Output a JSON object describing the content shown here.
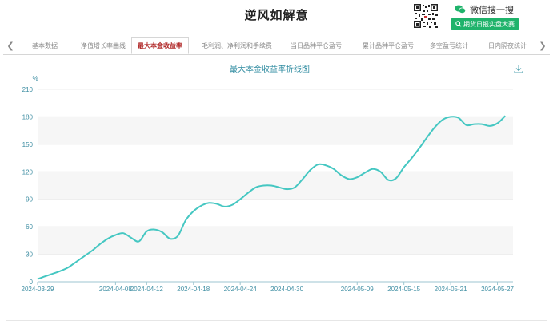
{
  "page": {
    "title": "逆风如解意"
  },
  "wechat": {
    "search_label": "微信搜一搜",
    "search_button": "期货日报实盘大赛"
  },
  "tabs": [
    {
      "label": "基本数据",
      "active": false
    },
    {
      "label": "净值增长率曲线",
      "active": false
    },
    {
      "label": "最大本金收益率",
      "active": true
    },
    {
      "label": "毛利润、净利润和手续费",
      "active": false
    },
    {
      "label": "当日品种平仓盈亏",
      "active": false
    },
    {
      "label": "累计品种平仓盈亏",
      "active": false
    },
    {
      "label": "多空盈亏统计",
      "active": false
    },
    {
      "label": "日内隔夜统计",
      "active": false
    }
  ],
  "colors": {
    "line": "#45c7c2",
    "title": "#2e8ba0",
    "axis_text": "#3f8ea3",
    "active_tab": "#b12a2a",
    "wechat_green": "#1fb36b"
  },
  "icons": [
    "chevron-left-icon",
    "chevron-right-icon",
    "download-icon",
    "wechat-icon",
    "search-icon",
    "qr-code"
  ],
  "chart_data": {
    "type": "line",
    "title": "最大本金收益率折线图",
    "ylabel": "%",
    "xlabel": "",
    "ylim": [
      0,
      210
    ],
    "yticks": [
      0,
      30,
      60,
      90,
      120,
      150,
      180,
      210
    ],
    "xlim": [
      "2024-03-29",
      "2024-05-29"
    ],
    "xticks": [
      "2024-03-29",
      "2024-04-08",
      "2024-04-12",
      "2024-04-18",
      "2024-04-24",
      "2024-04-30",
      "2024-05-09",
      "2024-05-15",
      "2024-05-21",
      "2024-05-27"
    ],
    "grid": true,
    "series": [
      {
        "points": [
          [
            "2024-03-29",
            3
          ],
          [
            "2024-03-30",
            6
          ],
          [
            "2024-03-31",
            9
          ],
          [
            "2024-04-01",
            12
          ],
          [
            "2024-04-02",
            16
          ],
          [
            "2024-04-03",
            22
          ],
          [
            "2024-04-04",
            28
          ],
          [
            "2024-04-05",
            34
          ],
          [
            "2024-04-06",
            41
          ],
          [
            "2024-04-07",
            47
          ],
          [
            "2024-04-08",
            51
          ],
          [
            "2024-04-09",
            53
          ],
          [
            "2024-04-10",
            48
          ],
          [
            "2024-04-11",
            44
          ],
          [
            "2024-04-12",
            55
          ],
          [
            "2024-04-13",
            57
          ],
          [
            "2024-04-14",
            54
          ],
          [
            "2024-04-15",
            47
          ],
          [
            "2024-04-16",
            50
          ],
          [
            "2024-04-17",
            67
          ],
          [
            "2024-04-18",
            77
          ],
          [
            "2024-04-19",
            83
          ],
          [
            "2024-04-20",
            86
          ],
          [
            "2024-04-21",
            85
          ],
          [
            "2024-04-22",
            82
          ],
          [
            "2024-04-23",
            84
          ],
          [
            "2024-04-24",
            90
          ],
          [
            "2024-04-25",
            97
          ],
          [
            "2024-04-26",
            103
          ],
          [
            "2024-04-27",
            105
          ],
          [
            "2024-04-28",
            105
          ],
          [
            "2024-04-29",
            103
          ],
          [
            "2024-04-30",
            101
          ],
          [
            "2024-05-01",
            103
          ],
          [
            "2024-05-02",
            112
          ],
          [
            "2024-05-03",
            122
          ],
          [
            "2024-05-04",
            128
          ],
          [
            "2024-05-05",
            127
          ],
          [
            "2024-05-06",
            123
          ],
          [
            "2024-05-07",
            116
          ],
          [
            "2024-05-08",
            112
          ],
          [
            "2024-05-09",
            114
          ],
          [
            "2024-05-10",
            119
          ],
          [
            "2024-05-11",
            123
          ],
          [
            "2024-05-12",
            120
          ],
          [
            "2024-05-13",
            111
          ],
          [
            "2024-05-14",
            113
          ],
          [
            "2024-05-15",
            125
          ],
          [
            "2024-05-16",
            135
          ],
          [
            "2024-05-17",
            146
          ],
          [
            "2024-05-18",
            158
          ],
          [
            "2024-05-19",
            169
          ],
          [
            "2024-05-20",
            177
          ],
          [
            "2024-05-21",
            180
          ],
          [
            "2024-05-22",
            179
          ],
          [
            "2024-05-23",
            171
          ],
          [
            "2024-05-24",
            172
          ],
          [
            "2024-05-25",
            172
          ],
          [
            "2024-05-26",
            170
          ],
          [
            "2024-05-27",
            173
          ],
          [
            "2024-05-28",
            181
          ]
        ]
      }
    ]
  }
}
